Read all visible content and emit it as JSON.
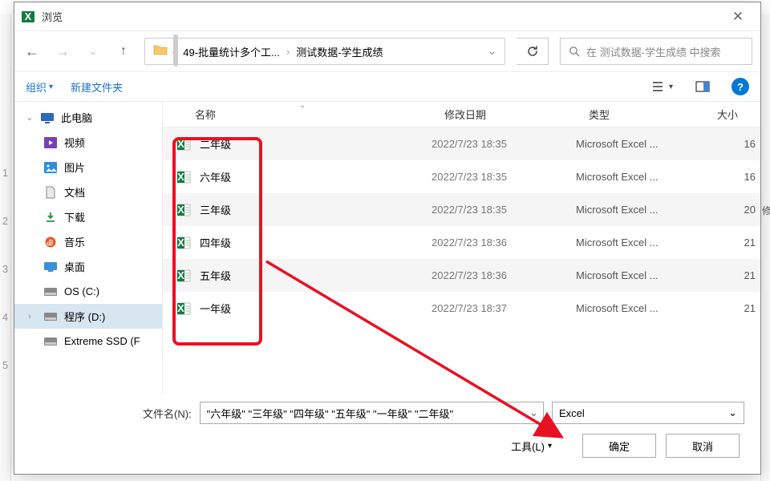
{
  "window": {
    "title": "浏览"
  },
  "nav": {
    "crumb_prefix": "«",
    "crumb_1": "49-批量统计多个工...",
    "crumb_2": "测试数据-学生成绩",
    "search_placeholder": "在 测试数据-学生成绩 中搜索"
  },
  "toolbar": {
    "organize": "组织",
    "newfolder": "新建文件夹"
  },
  "sidebar": {
    "items": [
      {
        "label": "此电脑"
      },
      {
        "label": "视频"
      },
      {
        "label": "图片"
      },
      {
        "label": "文档"
      },
      {
        "label": "下载"
      },
      {
        "label": "音乐"
      },
      {
        "label": "桌面"
      },
      {
        "label": "OS (C:)"
      },
      {
        "label": "程序 (D:)"
      },
      {
        "label": "Extreme SSD (F"
      }
    ]
  },
  "headers": {
    "name": "名称",
    "date": "修改日期",
    "type": "类型",
    "size": "大小"
  },
  "files": [
    {
      "name": "二年级",
      "date": "2022/7/23 18:35",
      "type": "Microsoft Excel ...",
      "size": "16"
    },
    {
      "name": "六年级",
      "date": "2022/7/23 18:35",
      "type": "Microsoft Excel ...",
      "size": "16"
    },
    {
      "name": "三年级",
      "date": "2022/7/23 18:35",
      "type": "Microsoft Excel ...",
      "size": "20"
    },
    {
      "name": "四年级",
      "date": "2022/7/23 18:36",
      "type": "Microsoft Excel ...",
      "size": "21"
    },
    {
      "name": "五年级",
      "date": "2022/7/23 18:36",
      "type": "Microsoft Excel ...",
      "size": "21"
    },
    {
      "name": "一年级",
      "date": "2022/7/23 18:37",
      "type": "Microsoft Excel ...",
      "size": "21"
    }
  ],
  "bottom": {
    "filename_label": "文件名(N):",
    "filename_value": "\"六年级\" \"三年级\" \"四年级\" \"五年级\" \"一年级\" \"二年级\"",
    "filter": "Excel",
    "tools": "工具(L)",
    "ok": "确定",
    "cancel": "取消"
  },
  "bg_rows": [
    "1",
    "2",
    "3",
    "4",
    "5"
  ],
  "bg_side": "修"
}
